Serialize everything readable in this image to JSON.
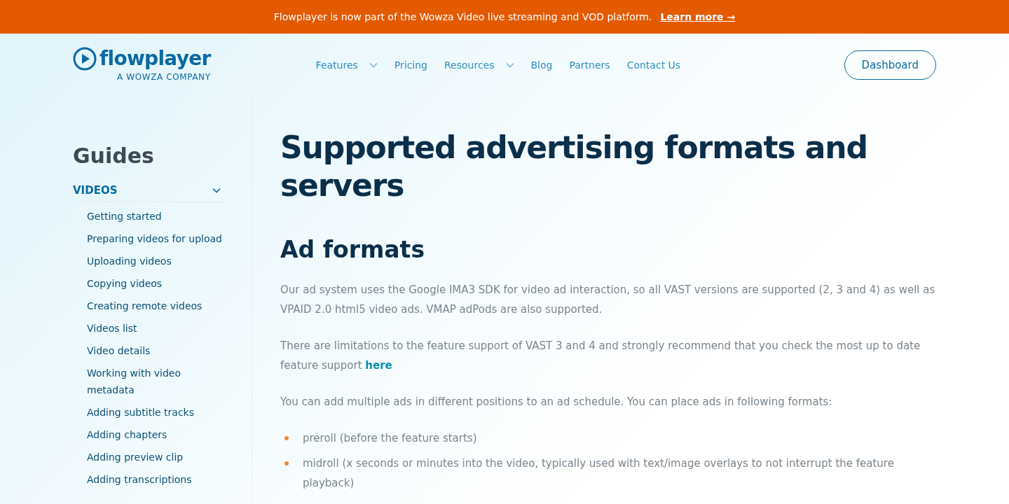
{
  "banner": {
    "text": "Flowplayer is now part of the Wowza Video live streaming and VOD platform.",
    "link": "Learn more →"
  },
  "header": {
    "logo": {
      "name": "flowplayer",
      "tagline": "A WOWZA COMPANY"
    },
    "nav": [
      {
        "label": "Features",
        "dropdown": true
      },
      {
        "label": "Pricing",
        "dropdown": false
      },
      {
        "label": "Resources",
        "dropdown": true
      },
      {
        "label": "Blog",
        "dropdown": false
      },
      {
        "label": "Partners",
        "dropdown": false
      },
      {
        "label": "Contact Us",
        "dropdown": false
      }
    ],
    "button": "Dashboard"
  },
  "sidebar": {
    "title": "Guides",
    "section": {
      "label": "VIDEOS",
      "expanded": true,
      "items": [
        "Getting started",
        "Preparing videos for upload",
        "Uploading videos",
        "Copying videos",
        "Creating remote videos",
        "Videos list",
        "Video details",
        "Working with video metadata",
        "Adding subtitle tracks",
        "Adding chapters",
        "Adding preview clip",
        "Adding transcriptions"
      ]
    }
  },
  "article": {
    "title": "Supported advertising formats and servers",
    "heading": "Ad formats",
    "paragraphs": [
      {
        "text": "Our ad system uses the Google IMA3 SDK for video ad interaction, so all VAST versions are supported (2, 3 and 4) as well as VPAID 2.0 html5 video ads. VMAP adPods are also supported."
      },
      {
        "text": "There are limitations to the feature support of VAST 3 and 4 and strongly recommend that you check the most up to date feature support",
        "link": "here"
      },
      {
        "text": "You can add multiple ads in different positions to an ad schedule. You can place ads in following formats:"
      }
    ],
    "bullets": [
      "preroll (before the feature starts)",
      "midroll (x seconds or minutes into the video, typically used with text/image overlays to not interrupt the feature playback)"
    ]
  }
}
